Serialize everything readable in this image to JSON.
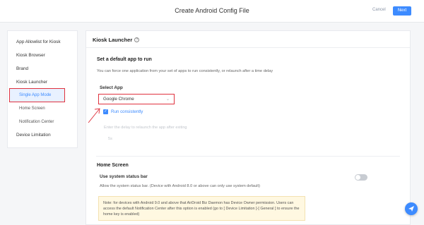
{
  "header": {
    "title": "Create Android Config File",
    "cancel_label": "Cancel",
    "next_label": "Next"
  },
  "sidebar": {
    "items": [
      {
        "label": "App Allowlist for Kiosk"
      },
      {
        "label": "Kiosk Browser"
      },
      {
        "label": "Brand"
      },
      {
        "label": "Kiosk Launcher"
      },
      {
        "label": "Single App Mode",
        "active": true
      },
      {
        "label": "Home Screen"
      },
      {
        "label": "Notification Center"
      },
      {
        "label": "Device Limitation"
      }
    ]
  },
  "panel": {
    "title": "Kiosk Launcher",
    "help_icon": "help-icon",
    "default_app": {
      "title": "Set a default app to run",
      "description": "You can force one application from your set of apps to run consistently, or relaunch after a time delay",
      "select_label": "Select App",
      "selected_app": "Google Chrome",
      "checkbox_label": "Run consistently",
      "checkbox_checked": true,
      "delay_text": "Enter the delay to relaunch the app after exiting",
      "delay_input_value": "5s"
    },
    "home_screen": {
      "title": "Home Screen",
      "status_bar_label": "Use system status bar",
      "status_bar_description": "Allow the system status bar. (Device with Android 8.0 or above can only use system default)",
      "status_bar_enabled": false,
      "note": "Note: for devices with Android 9.0 and above that AirDroid Biz Daemon has Device Owner permission. Users can access the default Notification Center after this option is enabled (go to [ Device Limitation ]-[ General ] to ensure the home key is enabled)"
    }
  },
  "colors": {
    "accent": "#3d8bff",
    "highlight_red": "#e0323e",
    "note_bg": "#fff8e1"
  }
}
